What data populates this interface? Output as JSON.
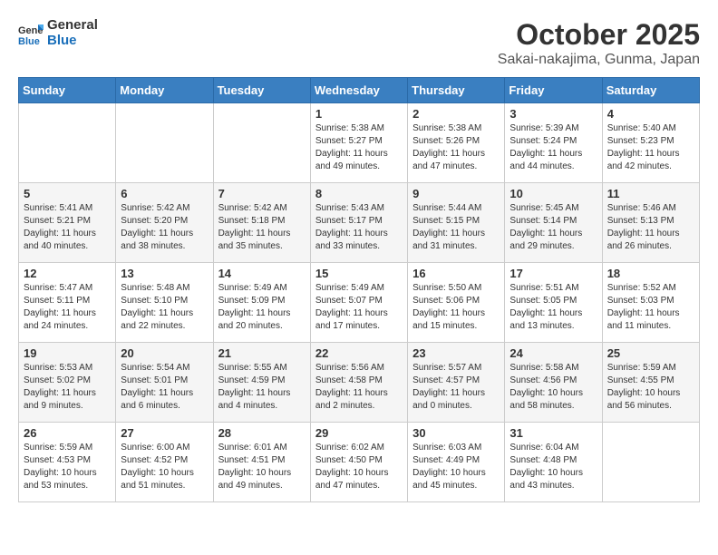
{
  "header": {
    "logo_general": "General",
    "logo_blue": "Blue",
    "month": "October 2025",
    "location": "Sakai-nakajima, Gunma, Japan"
  },
  "weekdays": [
    "Sunday",
    "Monday",
    "Tuesday",
    "Wednesday",
    "Thursday",
    "Friday",
    "Saturday"
  ],
  "rows": [
    [
      {
        "day": "",
        "content": ""
      },
      {
        "day": "",
        "content": ""
      },
      {
        "day": "",
        "content": ""
      },
      {
        "day": "1",
        "content": "Sunrise: 5:38 AM\nSunset: 5:27 PM\nDaylight: 11 hours\nand 49 minutes."
      },
      {
        "day": "2",
        "content": "Sunrise: 5:38 AM\nSunset: 5:26 PM\nDaylight: 11 hours\nand 47 minutes."
      },
      {
        "day": "3",
        "content": "Sunrise: 5:39 AM\nSunset: 5:24 PM\nDaylight: 11 hours\nand 44 minutes."
      },
      {
        "day": "4",
        "content": "Sunrise: 5:40 AM\nSunset: 5:23 PM\nDaylight: 11 hours\nand 42 minutes."
      }
    ],
    [
      {
        "day": "5",
        "content": "Sunrise: 5:41 AM\nSunset: 5:21 PM\nDaylight: 11 hours\nand 40 minutes."
      },
      {
        "day": "6",
        "content": "Sunrise: 5:42 AM\nSunset: 5:20 PM\nDaylight: 11 hours\nand 38 minutes."
      },
      {
        "day": "7",
        "content": "Sunrise: 5:42 AM\nSunset: 5:18 PM\nDaylight: 11 hours\nand 35 minutes."
      },
      {
        "day": "8",
        "content": "Sunrise: 5:43 AM\nSunset: 5:17 PM\nDaylight: 11 hours\nand 33 minutes."
      },
      {
        "day": "9",
        "content": "Sunrise: 5:44 AM\nSunset: 5:15 PM\nDaylight: 11 hours\nand 31 minutes."
      },
      {
        "day": "10",
        "content": "Sunrise: 5:45 AM\nSunset: 5:14 PM\nDaylight: 11 hours\nand 29 minutes."
      },
      {
        "day": "11",
        "content": "Sunrise: 5:46 AM\nSunset: 5:13 PM\nDaylight: 11 hours\nand 26 minutes."
      }
    ],
    [
      {
        "day": "12",
        "content": "Sunrise: 5:47 AM\nSunset: 5:11 PM\nDaylight: 11 hours\nand 24 minutes."
      },
      {
        "day": "13",
        "content": "Sunrise: 5:48 AM\nSunset: 5:10 PM\nDaylight: 11 hours\nand 22 minutes."
      },
      {
        "day": "14",
        "content": "Sunrise: 5:49 AM\nSunset: 5:09 PM\nDaylight: 11 hours\nand 20 minutes."
      },
      {
        "day": "15",
        "content": "Sunrise: 5:49 AM\nSunset: 5:07 PM\nDaylight: 11 hours\nand 17 minutes."
      },
      {
        "day": "16",
        "content": "Sunrise: 5:50 AM\nSunset: 5:06 PM\nDaylight: 11 hours\nand 15 minutes."
      },
      {
        "day": "17",
        "content": "Sunrise: 5:51 AM\nSunset: 5:05 PM\nDaylight: 11 hours\nand 13 minutes."
      },
      {
        "day": "18",
        "content": "Sunrise: 5:52 AM\nSunset: 5:03 PM\nDaylight: 11 hours\nand 11 minutes."
      }
    ],
    [
      {
        "day": "19",
        "content": "Sunrise: 5:53 AM\nSunset: 5:02 PM\nDaylight: 11 hours\nand 9 minutes."
      },
      {
        "day": "20",
        "content": "Sunrise: 5:54 AM\nSunset: 5:01 PM\nDaylight: 11 hours\nand 6 minutes."
      },
      {
        "day": "21",
        "content": "Sunrise: 5:55 AM\nSunset: 4:59 PM\nDaylight: 11 hours\nand 4 minutes."
      },
      {
        "day": "22",
        "content": "Sunrise: 5:56 AM\nSunset: 4:58 PM\nDaylight: 11 hours\nand 2 minutes."
      },
      {
        "day": "23",
        "content": "Sunrise: 5:57 AM\nSunset: 4:57 PM\nDaylight: 11 hours\nand 0 minutes."
      },
      {
        "day": "24",
        "content": "Sunrise: 5:58 AM\nSunset: 4:56 PM\nDaylight: 10 hours\nand 58 minutes."
      },
      {
        "day": "25",
        "content": "Sunrise: 5:59 AM\nSunset: 4:55 PM\nDaylight: 10 hours\nand 56 minutes."
      }
    ],
    [
      {
        "day": "26",
        "content": "Sunrise: 5:59 AM\nSunset: 4:53 PM\nDaylight: 10 hours\nand 53 minutes."
      },
      {
        "day": "27",
        "content": "Sunrise: 6:00 AM\nSunset: 4:52 PM\nDaylight: 10 hours\nand 51 minutes."
      },
      {
        "day": "28",
        "content": "Sunrise: 6:01 AM\nSunset: 4:51 PM\nDaylight: 10 hours\nand 49 minutes."
      },
      {
        "day": "29",
        "content": "Sunrise: 6:02 AM\nSunset: 4:50 PM\nDaylight: 10 hours\nand 47 minutes."
      },
      {
        "day": "30",
        "content": "Sunrise: 6:03 AM\nSunset: 4:49 PM\nDaylight: 10 hours\nand 45 minutes."
      },
      {
        "day": "31",
        "content": "Sunrise: 6:04 AM\nSunset: 4:48 PM\nDaylight: 10 hours\nand 43 minutes."
      },
      {
        "day": "",
        "content": ""
      }
    ]
  ]
}
